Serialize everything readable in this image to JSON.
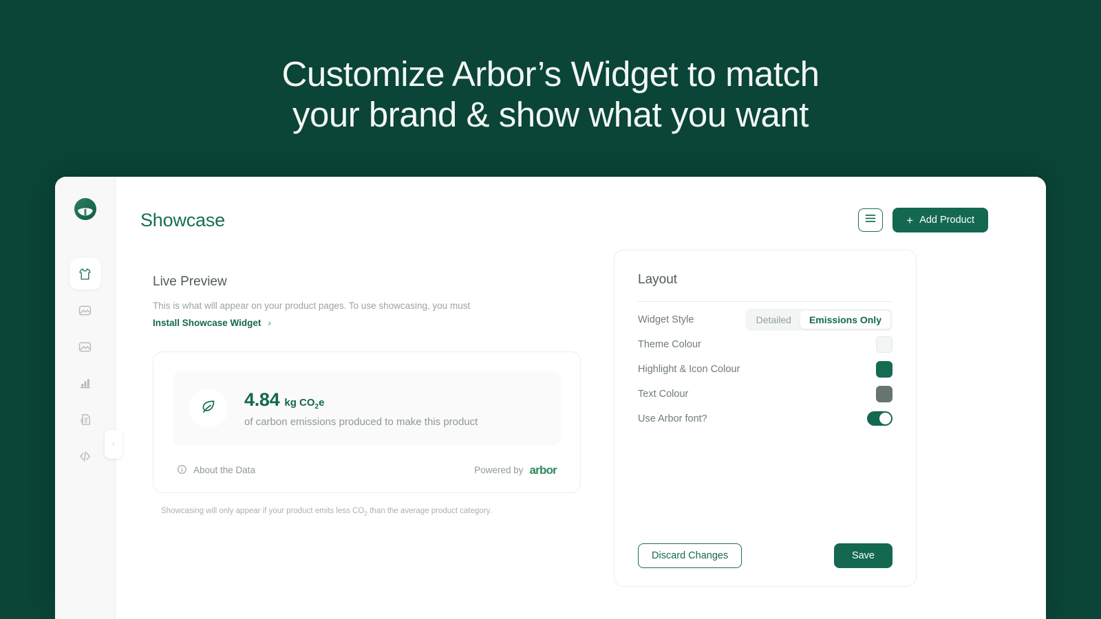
{
  "hero": {
    "line1": "Customize Arbor’s Widget to match",
    "line2": "your brand & show what you want"
  },
  "colors": {
    "background": "#0a4537",
    "brand_green": "#13684f",
    "accent_green": "#2f8a5f",
    "muted_text": "#8d9a96"
  },
  "sidebar": {
    "logo_name": "arbor-logo",
    "items": [
      {
        "icon": "tshirt-icon",
        "name": "products",
        "active": true
      },
      {
        "icon": "image-icon",
        "name": "showcase-images",
        "active": false
      },
      {
        "icon": "image-icon",
        "name": "media",
        "active": false
      },
      {
        "icon": "bar-chart-icon",
        "name": "analytics",
        "active": false
      },
      {
        "icon": "document-icon",
        "name": "reports",
        "active": false
      },
      {
        "icon": "code-icon",
        "name": "developer",
        "active": false
      }
    ],
    "collapse_glyph": "›"
  },
  "topbar": {
    "title": "Showcase",
    "menu_icon": "hamburger-icon",
    "add_product_label": "Add Product",
    "add_product_plus": "+"
  },
  "preview": {
    "section_title": "Live Preview",
    "description": "This is what will appear on your product pages. To use showcasing, you must",
    "install_link": "Install Showcase Widget",
    "install_chevron": "›",
    "widget": {
      "leaf_icon": "leaf-icon",
      "value": "4.84",
      "unit_prefix": "kg CO",
      "unit_sub": "2",
      "unit_suffix": "e",
      "caption": "of carbon emissions produced to make this product",
      "about_icon": "info-icon",
      "about_label": "About the Data",
      "powered_by_label": "Powered by",
      "brand_wordmark": "arbor"
    },
    "footnote_pre": "Showcasing will only appear if your product emits less CO",
    "footnote_sub": "2",
    "footnote_post": " than the average product category."
  },
  "panel": {
    "title": "Layout",
    "rows": [
      {
        "label": "Widget Style",
        "control": "segmented",
        "options": [
          "Detailed",
          "Emissions Only"
        ],
        "selected": "Emissions Only"
      },
      {
        "label": "Theme Colour",
        "control": "swatch",
        "value": "#f4f6f5"
      },
      {
        "label": "Highlight & Icon Colour",
        "control": "swatch",
        "value": "#156b52"
      },
      {
        "label": "Text Colour",
        "control": "swatch",
        "value": "#68756f"
      },
      {
        "label": "Use Arbor font?",
        "control": "toggle",
        "value": "on"
      }
    ],
    "discard_label": "Discard Changes",
    "save_label": "Save"
  }
}
